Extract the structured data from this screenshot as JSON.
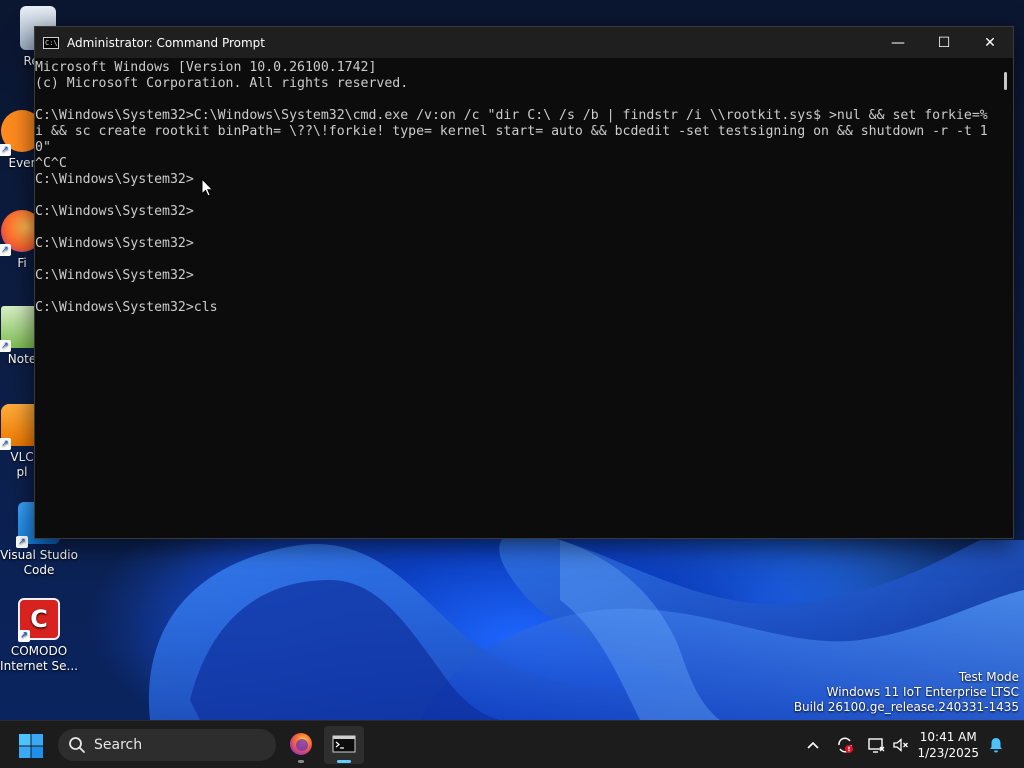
{
  "desktop": {
    "icons": [
      {
        "label": "Recy",
        "icon": "recycle-bin-icon"
      },
      {
        "label": "Ever",
        "icon": "everything-icon"
      },
      {
        "label": "Fi",
        "icon": "firefox-icon"
      },
      {
        "label": "Note",
        "icon": "notepad-icon"
      },
      {
        "label": "VLC\npl",
        "icon": "vlc-icon"
      },
      {
        "label": "Visual Studio\nCode",
        "icon": "vscode-icon"
      },
      {
        "label": "COMODO\nInternet Se...",
        "icon": "comodo-icon"
      }
    ]
  },
  "window": {
    "title": "Administrator: Command Prompt",
    "minimize": "—",
    "maximize": "☐",
    "close": "✕",
    "lines": [
      "Microsoft Windows [Version 10.0.26100.1742]",
      "(c) Microsoft Corporation. All rights reserved.",
      "",
      "C:\\Windows\\System32>C:\\Windows\\System32\\cmd.exe /v:on /c \"dir C:\\ /s /b | findstr /i \\\\rootkit.sys$ >nul && set forkie=%",
      "i && sc create rootkit binPath= \\??\\!forkie! type= kernel start= auto && bcdedit -set testsigning on && shutdown -r -t 1",
      "0\"",
      "^C^C",
      "C:\\Windows\\System32>",
      "",
      "C:\\Windows\\System32>",
      "",
      "C:\\Windows\\System32>",
      "",
      "C:\\Windows\\System32>",
      "",
      "C:\\Windows\\System32>cls"
    ]
  },
  "watermark": {
    "line1": "Test Mode",
    "line2": "Windows 11 IoT Enterprise LTSC",
    "line3": "Build 26100.ge_release.240331-1435"
  },
  "taskbar": {
    "search_label": "Search",
    "time": "10:41 AM",
    "date": "1/23/2025"
  },
  "colors": {
    "console_bg": "#0c0c0c",
    "console_text": "#cccccc",
    "accent": "#60cdff"
  }
}
